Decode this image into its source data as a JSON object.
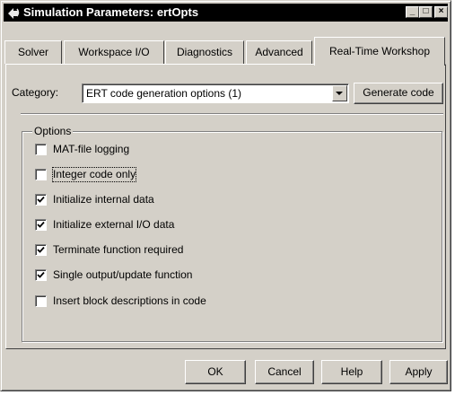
{
  "window": {
    "title": "Simulation Parameters: ertOpts"
  },
  "title_buttons": {
    "minimize": "_",
    "maximize": "□",
    "close": "×"
  },
  "tabs": [
    {
      "label": "Solver"
    },
    {
      "label": "Workspace I/O"
    },
    {
      "label": "Diagnostics"
    },
    {
      "label": "Advanced"
    },
    {
      "label": "Real-Time Workshop"
    }
  ],
  "category": {
    "label": "Category:",
    "value": "ERT code generation options (1)"
  },
  "generate_button": "Generate code",
  "options": {
    "legend": "Options",
    "items": [
      {
        "label": "MAT-file logging",
        "checked": false
      },
      {
        "label": "Integer code only",
        "checked": false
      },
      {
        "label": "Initialize internal data",
        "checked": true
      },
      {
        "label": "Initialize external I/O data",
        "checked": true
      },
      {
        "label": "Terminate function required",
        "checked": true
      },
      {
        "label": "Single output/update function",
        "checked": true
      },
      {
        "label": "Insert block descriptions in code",
        "checked": false
      }
    ]
  },
  "buttons": {
    "ok": "OK",
    "cancel": "Cancel",
    "help": "Help",
    "apply": "Apply"
  },
  "colors": {
    "face": "#d4d0c8",
    "titlebar": "#000000"
  },
  "icons": {
    "app": "simulink-icon",
    "check": "check-icon",
    "arrow": "chevron-down-icon"
  }
}
